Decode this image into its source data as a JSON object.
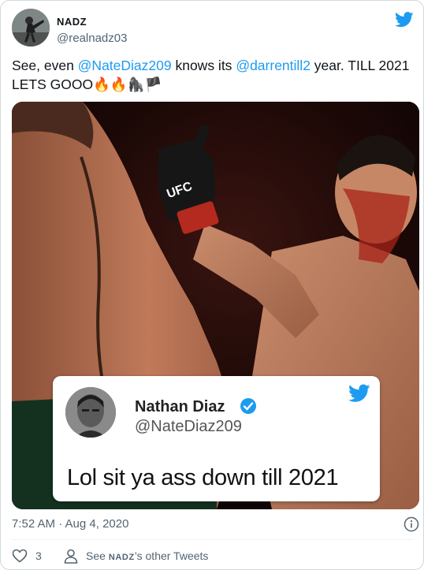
{
  "tweet": {
    "author": {
      "display_name": "NADZ",
      "handle": "@realnadz03"
    },
    "text": {
      "part1": "See, even ",
      "mention1": "@NateDiaz209",
      "part2": " knows its ",
      "mention2": "@darrentill2",
      "part3": " year. TILL 2021 LETS GOOO",
      "emojis": "🔥🔥🦍🏴"
    },
    "media": {
      "glove_text": "UFC",
      "embedded_tweet": {
        "display_name": "Nathan Diaz",
        "handle": "@NateDiaz209",
        "text": "Lol sit ya ass down till 2021"
      }
    },
    "timestamp": "7:52 AM · Aug 4, 2020",
    "like_count": "3",
    "see_other_prefix": "See ",
    "see_other_name": "NADZ",
    "see_other_suffix": "’s other Tweets"
  },
  "colors": {
    "link": "#1d9bf0",
    "secondary_text": "#536471",
    "twitter_blue": "#1d9bf0"
  },
  "icons": [
    "twitter-bird-icon",
    "verified-badge-icon",
    "info-icon",
    "heart-icon",
    "person-icon"
  ]
}
